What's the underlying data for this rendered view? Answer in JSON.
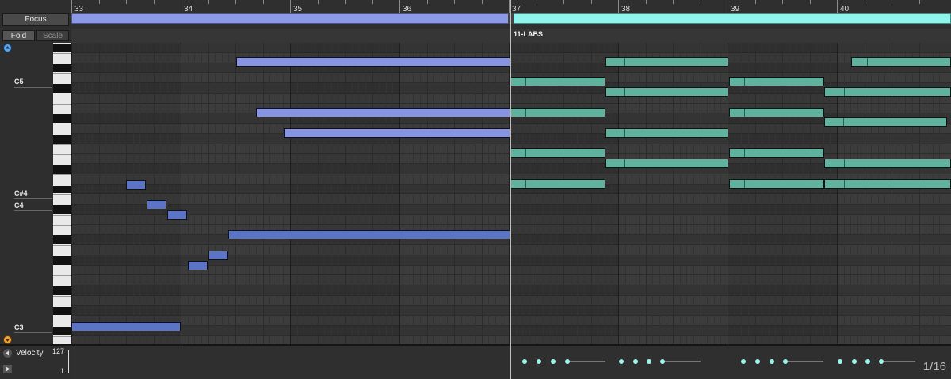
{
  "left_panel": {
    "focus_label": "Focus",
    "fold_label": "Fold",
    "scale_label": "Scale"
  },
  "ruler": {
    "bars": [
      "33",
      "34",
      "35",
      "36",
      "37",
      "38",
      "39",
      "40"
    ],
    "clip_name": "11-LABS"
  },
  "piano_labels": [
    "C5",
    "C#4",
    "C4",
    "C3"
  ],
  "velocity": {
    "label": "Velocity",
    "max": "127",
    "min": "1",
    "grid_readout": "1/16"
  },
  "colors": {
    "loop_blue": "#8c9ae8",
    "loop_teal": "#8ff5ec",
    "note_blue": "#8793e3",
    "note_blue_dark": "#5b74c6",
    "note_teal": "#5fb39e"
  },
  "icons": {
    "scroll_up": "arrow-up-circle-icon",
    "scroll_down": "arrow-down-circle-icon",
    "velocity_back": "arrow-left-icon",
    "velocity_play": "play-icon"
  }
}
